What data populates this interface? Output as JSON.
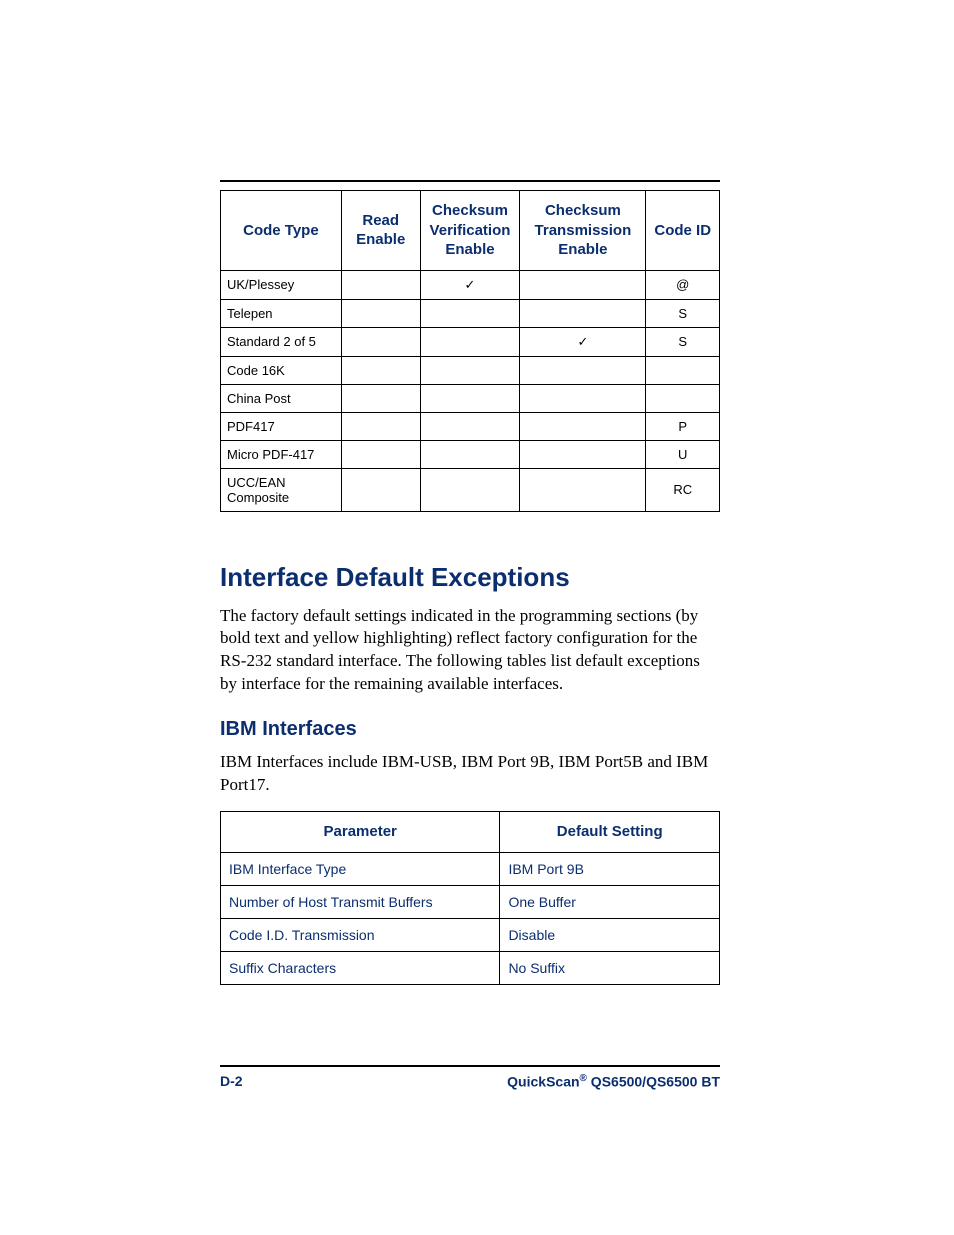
{
  "table1": {
    "headers": {
      "col1": "Code Type",
      "col2": "Read Enable",
      "col3": "Checksum Verification Enable",
      "col4": "Checksum Transmission Enable",
      "col5": "Code ID"
    },
    "rows": [
      {
        "type": "UK/Plessey",
        "read": "",
        "cve": "✓",
        "cte": "",
        "id": "@"
      },
      {
        "type": "Telepen",
        "read": "",
        "cve": "",
        "cte": "",
        "id": "S"
      },
      {
        "type": "Standard 2 of 5",
        "read": "",
        "cve": "",
        "cte": "✓",
        "id": "S"
      },
      {
        "type": "Code 16K",
        "read": "",
        "cve": "",
        "cte": "",
        "id": ""
      },
      {
        "type": "China Post",
        "read": "",
        "cve": "",
        "cte": "",
        "id": ""
      },
      {
        "type": "PDF417",
        "read": "",
        "cve": "",
        "cte": "",
        "id": "P"
      },
      {
        "type": "Micro PDF-417",
        "read": "",
        "cve": "",
        "cte": "",
        "id": "U"
      },
      {
        "type": "UCC/EAN Composite",
        "read": "",
        "cve": "",
        "cte": "",
        "id": "RC"
      }
    ]
  },
  "section": {
    "heading": "Interface Default Exceptions",
    "para": "The factory default settings indicated in the programming sections (by bold text and yellow highlighting) reflect factory configuration for the RS-232 standard interface. The following tables list default exceptions by interface for the remaining available interfaces."
  },
  "subsection": {
    "heading": "IBM Interfaces",
    "para": "IBM Interfaces include IBM-USB, IBM Port 9B, IBM Port5B and IBM Port17."
  },
  "table2": {
    "headers": {
      "col1": "Parameter",
      "col2": "Default Setting"
    },
    "rows": [
      {
        "param": "IBM Interface Type",
        "setting": "IBM Port 9B"
      },
      {
        "param": "Number of Host Transmit Buffers",
        "setting": "One Buffer"
      },
      {
        "param": "Code I.D. Transmission",
        "setting": "Disable"
      },
      {
        "param": "Suffix Characters",
        "setting": "No Suffix"
      }
    ]
  },
  "footer": {
    "page": "D-2",
    "product_prefix": "QuickScan",
    "reg": "®",
    "product_suffix": " QS6500/QS6500 BT"
  }
}
